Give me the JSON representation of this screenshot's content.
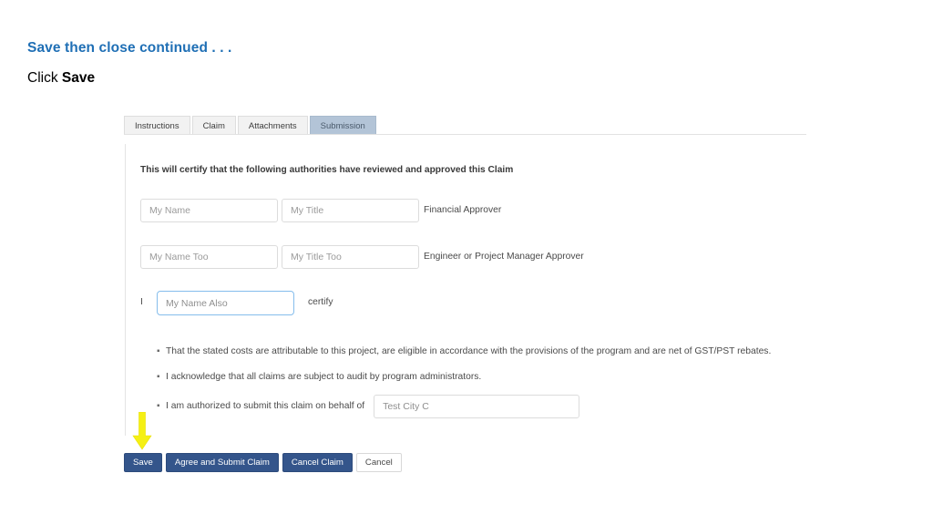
{
  "slide": {
    "heading": "Save then close continued . . .",
    "instruction_prefix": "Click ",
    "instruction_strong": "Save"
  },
  "tabs": [
    {
      "label": "Instructions",
      "active": false
    },
    {
      "label": "Claim",
      "active": false
    },
    {
      "label": "Attachments",
      "active": false
    },
    {
      "label": "Submission",
      "active": true
    }
  ],
  "form": {
    "certify_title": "This will certify that the following authorities have reviewed and approved this Claim",
    "rows": [
      {
        "name_value": "My Name",
        "title_value": "My Title",
        "role_label": "Financial Approver"
      },
      {
        "name_value": "My Name Too",
        "title_value": "My Title Too",
        "role_label": "Engineer or Project Manager Approver"
      }
    ],
    "certify_row": {
      "prefix": "I",
      "name_value": "My Name Also",
      "suffix": "certify"
    },
    "bullets": [
      {
        "text": "That the stated costs are attributable to this project, are eligible in accordance with the provisions of the program and are net of GST/PST rebates.",
        "field_value": null
      },
      {
        "text": "I acknowledge that all claims are subject to audit by program administrators.",
        "field_value": null
      },
      {
        "text": "I am authorized to submit this claim on behalf of",
        "field_value": "Test City C"
      }
    ],
    "bullet_marker": "▪"
  },
  "buttons": [
    {
      "label": "Save",
      "style": "primary"
    },
    {
      "label": "Agree and Submit Claim",
      "style": "primary"
    },
    {
      "label": "Cancel Claim",
      "style": "primary"
    },
    {
      "label": "Cancel",
      "style": "plain"
    }
  ],
  "colors": {
    "heading_blue": "#1f6fb5",
    "button_blue": "#34558b",
    "active_tab": "#b3c4d7",
    "focus_border": "#85bdec",
    "arrow_yellow": "#f5f014"
  }
}
